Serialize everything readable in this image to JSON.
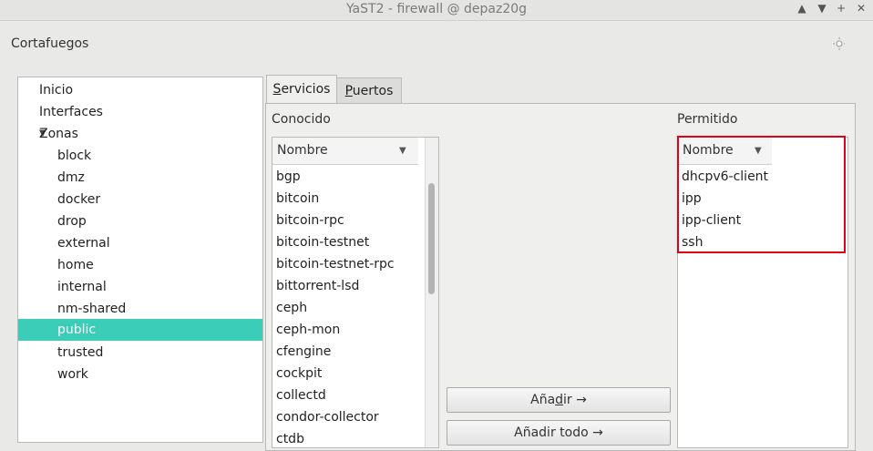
{
  "window": {
    "title": "YaST2 - firewall @ depaz20g",
    "controls": [
      "arrow-up-icon",
      "arrow-down-icon",
      "plus-icon",
      "close-icon"
    ]
  },
  "app": {
    "heading": "Cortafuegos",
    "daynight_icon": "day-night-toggle-icon"
  },
  "tree": {
    "items": [
      {
        "label": "Inicio",
        "level": 1
      },
      {
        "label": "Interfaces",
        "level": 1
      },
      {
        "label": "Zonas",
        "level": 1,
        "expanded": true
      },
      {
        "label": "block",
        "level": 2
      },
      {
        "label": "dmz",
        "level": 2
      },
      {
        "label": "docker",
        "level": 2
      },
      {
        "label": "drop",
        "level": 2
      },
      {
        "label": "external",
        "level": 2
      },
      {
        "label": "home",
        "level": 2
      },
      {
        "label": "internal",
        "level": 2
      },
      {
        "label": "nm-shared",
        "level": 2
      },
      {
        "label": "public",
        "level": 2,
        "selected": true
      },
      {
        "label": "trusted",
        "level": 2
      },
      {
        "label": "work",
        "level": 2
      }
    ]
  },
  "tabs": {
    "services": {
      "label": "Servicios",
      "mnemonic": "S",
      "rest": "ervicios",
      "active": true
    },
    "ports": {
      "label": "Puertos",
      "mnemonic": "P",
      "rest": "uertos",
      "active": false
    }
  },
  "known": {
    "label": "Conocido",
    "column_header": "Nombre",
    "items": [
      "bgp",
      "bitcoin",
      "bitcoin-rpc",
      "bitcoin-testnet",
      "bitcoin-testnet-rpc",
      "bittorrent-lsd",
      "ceph",
      "ceph-mon",
      "cfengine",
      "cockpit",
      "collectd",
      "condor-collector",
      "ctdb"
    ]
  },
  "allowed": {
    "label": "Permitido",
    "column_header": "Nombre",
    "items": [
      "dhcpv6-client",
      "ipp",
      "ipp-client",
      "ssh"
    ]
  },
  "buttons": {
    "add": {
      "label": "Añadir →",
      "pre": "Aña",
      "mnemonic": "d",
      "post": "ir →"
    },
    "add_all": {
      "label": "Añadir todo →"
    }
  },
  "colors": {
    "selection": "#3ccdb8",
    "highlight_box": "#e0001a"
  }
}
